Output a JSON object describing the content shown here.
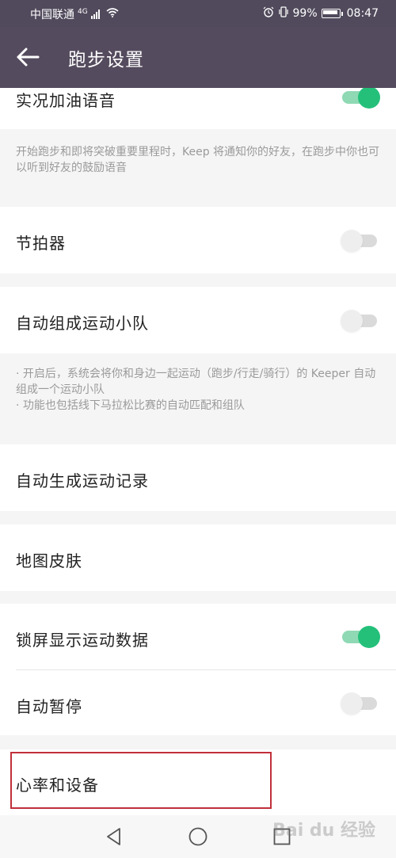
{
  "status_bar": {
    "carrier": "中国联通",
    "network": "4G",
    "battery": "99%",
    "time": "08:47"
  },
  "app_bar": {
    "title": "跑步设置"
  },
  "settings": {
    "live_cheer_voice": {
      "label": "实况加油语音",
      "enabled": true
    },
    "live_cheer_desc": "开始跑步和即将突破重要里程时，Keep 将通知你的好友，在跑步中你也可以听到好友的鼓励语音",
    "metronome": {
      "label": "节拍器",
      "enabled": false
    },
    "auto_team": {
      "label": "自动组成运动小队",
      "enabled": false
    },
    "auto_team_desc_1": "· 开启后，系统会将你和身边一起运动（跑步/行走/骑行）的 Keeper 自动组成一个运动小队",
    "auto_team_desc_2": "· 功能也包括线下马拉松比赛的自动匹配和组队",
    "auto_record": {
      "label": "自动生成运动记录"
    },
    "map_skin": {
      "label": "地图皮肤"
    },
    "lock_screen_data": {
      "label": "锁屏显示运动数据",
      "enabled": true
    },
    "auto_pause": {
      "label": "自动暂停",
      "enabled": false
    },
    "heart_rate_devices": {
      "label": "心率和设备"
    }
  },
  "colors": {
    "app_bar": "#554b5e",
    "toggle_on": "#24c07a",
    "highlight": "#c0303a"
  },
  "watermark": "Bai du 经验"
}
